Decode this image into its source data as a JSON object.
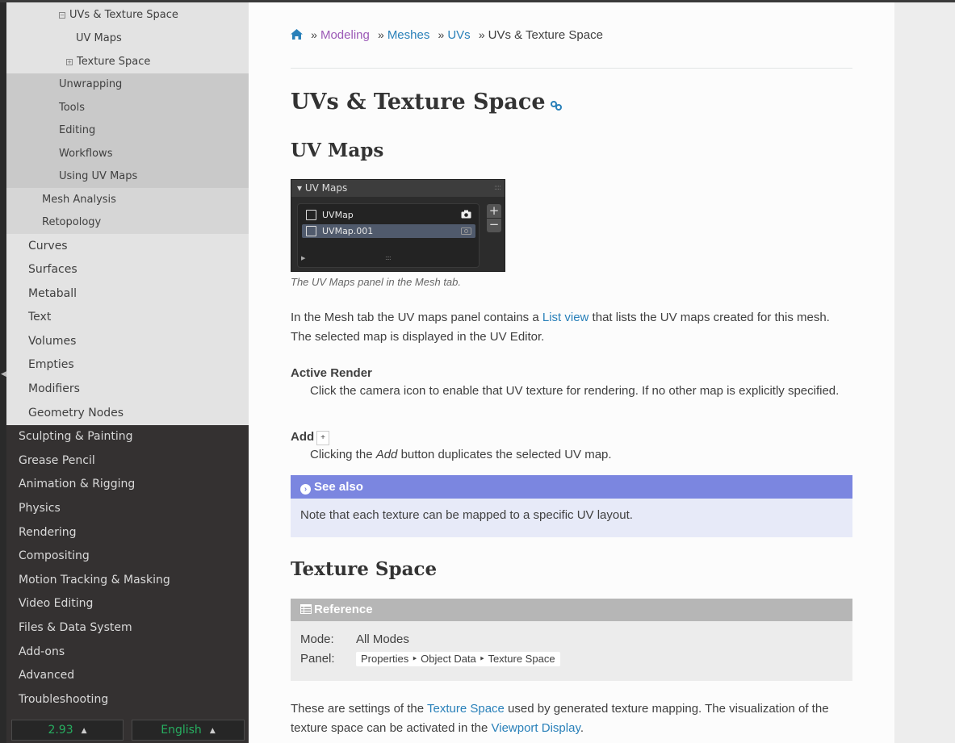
{
  "sidebar": {
    "items": [
      {
        "label": "UVs & Texture Space",
        "level": "l4",
        "toggle": "−"
      },
      {
        "label": "UV Maps",
        "level": "l4"
      },
      {
        "label": "Texture Space",
        "level": "l4",
        "toggle": "+"
      },
      {
        "label": "Unwrapping",
        "level": "l3"
      },
      {
        "label": "Tools",
        "level": "l3"
      },
      {
        "label": "Editing",
        "level": "l3"
      },
      {
        "label": "Workflows",
        "level": "l3"
      },
      {
        "label": "Using UV Maps",
        "level": "l3"
      },
      {
        "label": "Mesh Analysis",
        "level": "l2"
      },
      {
        "label": "Retopology",
        "level": "l2"
      },
      {
        "label": "Curves",
        "level": "l1"
      },
      {
        "label": "Surfaces",
        "level": "l1"
      },
      {
        "label": "Metaball",
        "level": "l1"
      },
      {
        "label": "Text",
        "level": "l1"
      },
      {
        "label": "Volumes",
        "level": "l1"
      },
      {
        "label": "Empties",
        "level": "l1"
      },
      {
        "label": "Modifiers",
        "level": "l1"
      },
      {
        "label": "Geometry Nodes",
        "level": "l1"
      },
      {
        "label": "Sculpting & Painting",
        "level": "l0"
      },
      {
        "label": "Grease Pencil",
        "level": "l0"
      },
      {
        "label": "Animation & Rigging",
        "level": "l0"
      },
      {
        "label": "Physics",
        "level": "l0"
      },
      {
        "label": "Rendering",
        "level": "l0"
      },
      {
        "label": "Compositing",
        "level": "l0"
      },
      {
        "label": "Motion Tracking & Masking",
        "level": "l0"
      },
      {
        "label": "Video Editing",
        "level": "l0"
      },
      {
        "label": "Files & Data System",
        "level": "l0"
      },
      {
        "label": "Add-ons",
        "level": "l0"
      },
      {
        "label": "Advanced",
        "level": "l0"
      },
      {
        "label": "Troubleshooting",
        "level": "l0"
      }
    ],
    "version": "2.93",
    "language": "English"
  },
  "breadcrumb": {
    "items": [
      "Modeling",
      "Meshes",
      "UVs"
    ],
    "current": "UVs & Texture Space",
    "separator": "»"
  },
  "page": {
    "title": "UVs & Texture Space",
    "uv_maps": {
      "heading": "UV Maps",
      "panel": {
        "header": "UV Maps",
        "rows": [
          "UVMap",
          "UVMap.001"
        ],
        "selected_row": "UVMap.001",
        "add": "+",
        "remove": "−"
      },
      "caption": "The UV Maps panel in the Mesh tab.",
      "intro_before": "In the Mesh tab the UV maps panel contains a ",
      "intro_link": "List view",
      "intro_after": " that lists the UV maps created for this mesh. The selected map is displayed in the UV Editor.",
      "active_render_term": "Active Render",
      "active_render_desc": "Click the camera icon to enable that UV texture for rendering. If no other map is explicitly specified.",
      "add_term": "Add",
      "add_key": "+",
      "add_desc_before": "Clicking the ",
      "add_desc_em": "Add",
      "add_desc_after": " button duplicates the selected UV map.",
      "see_also_title": "See also",
      "see_also_body": "Note that each texture can be mapped to a specific UV layout."
    },
    "texture_space": {
      "heading": "Texture Space",
      "reference_title": "Reference",
      "mode_label": "Mode:",
      "mode_value": "All Modes",
      "panel_label": "Panel:",
      "panel_value": "Properties ‣ Object Data ‣ Texture Space",
      "text_before": "These are settings of the ",
      "text_link1": "Texture Space",
      "text_middle": " used by generated texture mapping. The visualization of the texture space can be activated in the ",
      "text_link2": "Viewport Display",
      "text_after": "."
    }
  },
  "colors": {
    "link": "#2980b9",
    "visited_link": "#9b59b6",
    "see_also": "#7b86e0",
    "reference": "#b6b6b6",
    "version_green": "#27ae60"
  }
}
